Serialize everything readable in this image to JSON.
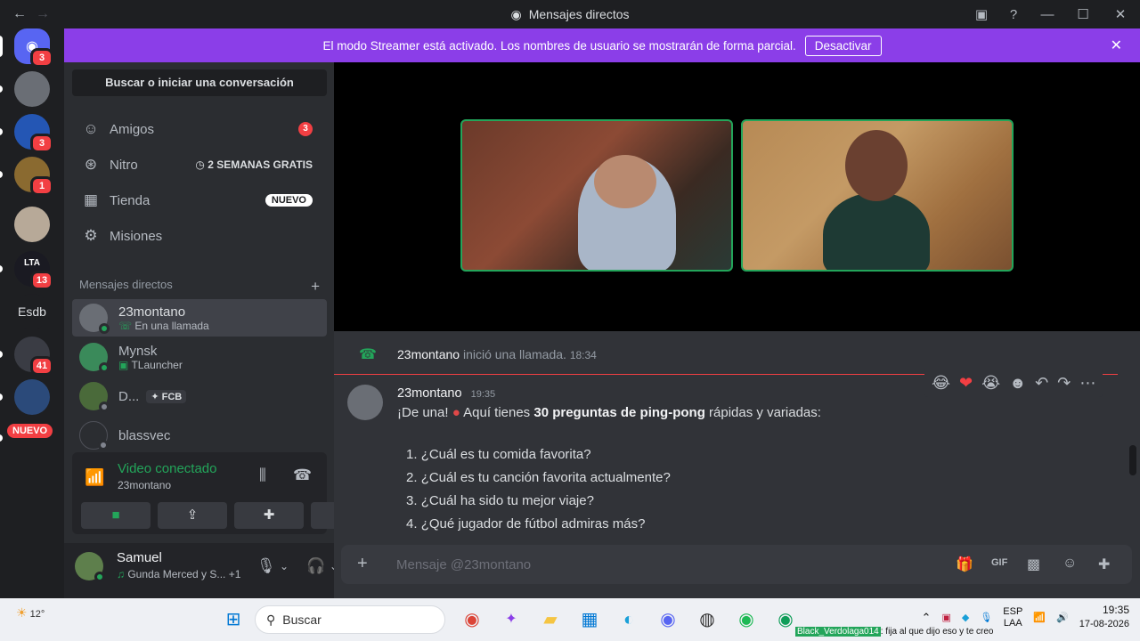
{
  "window": {
    "title": "Mensajes directos"
  },
  "banner": {
    "text": "El modo Streamer está activado. Los nombres de usuario se mostrarán de forma parcial.",
    "button": "Desactivar"
  },
  "guilds": [
    {
      "badge": "3"
    },
    {
      "badge": ""
    },
    {
      "badge": "3"
    },
    {
      "badge": "1"
    },
    {
      "badge": ""
    },
    {
      "label": "LTA",
      "badge": "13"
    },
    {
      "label": "Esdb",
      "badge": ""
    },
    {
      "badge": "41"
    },
    {
      "badge": ""
    },
    {
      "label": "NUEVO",
      "badge": "2"
    }
  ],
  "sidebar": {
    "search": "Buscar o iniciar una conversación",
    "nav": {
      "friends": {
        "label": "Amigos",
        "badge": "3"
      },
      "nitro": {
        "label": "Nitro",
        "tag": "2 SEMANAS GRATIS"
      },
      "shop": {
        "label": "Tienda",
        "tag": "NUEVO"
      },
      "quests": {
        "label": "Misiones"
      }
    },
    "dm_header": "Mensajes directos",
    "dms": [
      {
        "name": "23montano",
        "sub": "En una llamada"
      },
      {
        "name": "Mynsk",
        "sub": "TLauncher"
      },
      {
        "name": "D...",
        "sub": "FCB"
      },
      {
        "name": "blassvec",
        "sub": ""
      }
    ],
    "voice": {
      "title": "Video conectado",
      "sub": "23montano"
    },
    "user": {
      "name": "Samuel",
      "status": "Gunda Merced y S...",
      "extra": "+1"
    }
  },
  "chat": {
    "system": {
      "user": "23montano",
      "action": "inició una llamada.",
      "time": "18:34"
    },
    "message": {
      "author": "23montano",
      "time": "19:35",
      "intro": "¡De una!",
      "intro2": "Aquí tienes",
      "bold": "30 preguntas de ping-pong",
      "tail": "rápidas y variadas:",
      "items": [
        "¿Cuál es tu comida favorita?",
        "¿Cuál es tu canción favorita actualmente?",
        "¿Cuál ha sido tu mejor viaje?",
        "¿Qué jugador de fútbol admiras más?"
      ]
    },
    "composer_placeholder": "Mensaje @23montano"
  },
  "taskbar": {
    "weather": "12°",
    "search": "Buscar",
    "lang1": "ESP",
    "lang2": "LAA",
    "time": "19:35",
    "date": "17-08-2026",
    "ticker_user": "Black_Verdolaga014",
    "ticker_text": ": fija al que dijo eso y te creo"
  }
}
